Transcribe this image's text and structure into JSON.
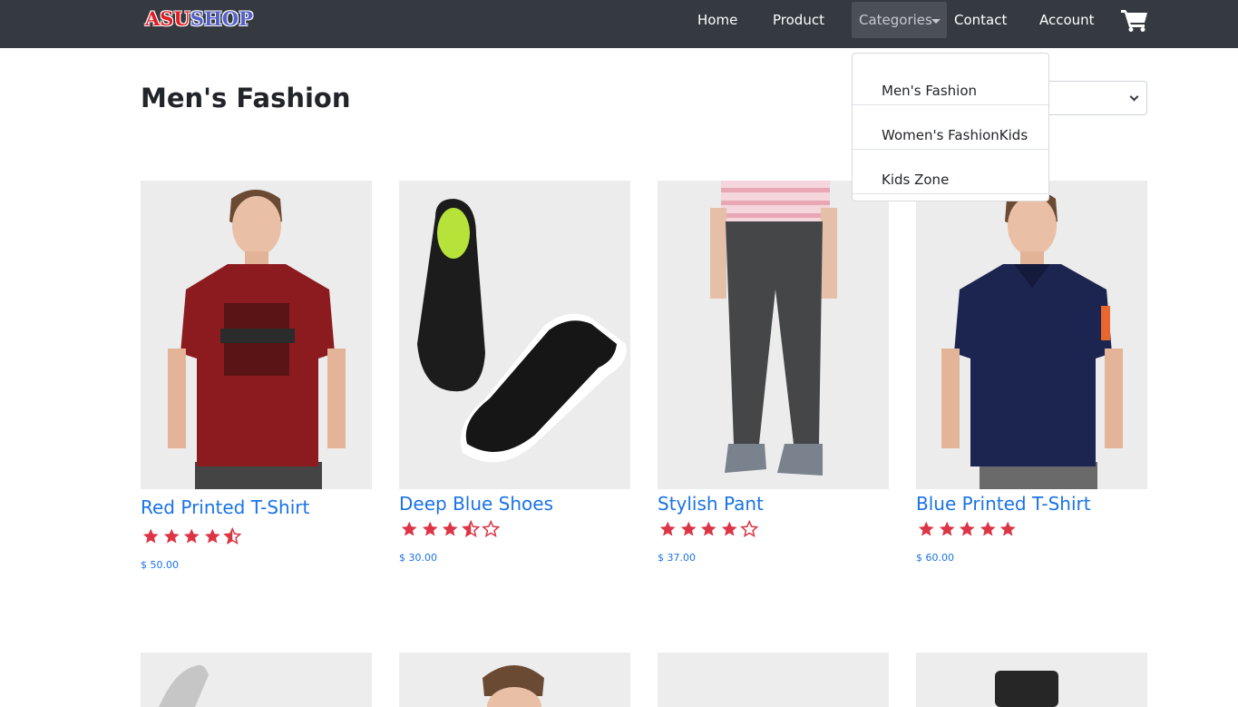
{
  "brand": {
    "logo_part1": "ASU",
    "logo_part2": "SHOP"
  },
  "nav": {
    "home": "Home",
    "product": "Product",
    "categories": "Categories",
    "contact": "Contact",
    "account": "Account",
    "cart_icon": "shopping-cart-icon"
  },
  "categories_menu": [
    "Men's Fashion",
    "Women's FashionKids",
    "Kids Zone"
  ],
  "page": {
    "title": "Men's Fashion"
  },
  "colors": {
    "navbar": "#343a40",
    "link": "#1a73e8",
    "star": "#dc3545"
  },
  "products": [
    {
      "name": "Red Printed T-Shirt",
      "rating": 4.5,
      "price": "$ 50.00"
    },
    {
      "name": "Deep Blue Shoes",
      "rating": 3.5,
      "price": "$ 30.00"
    },
    {
      "name": "Stylish Pant",
      "rating": 4,
      "price": "$ 37.00"
    },
    {
      "name": "Blue Printed T-Shirt",
      "rating": 5,
      "price": "$ 60.00"
    }
  ]
}
